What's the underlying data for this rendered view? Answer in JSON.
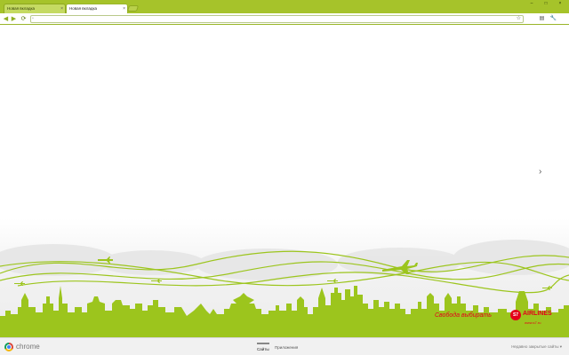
{
  "tabs": [
    {
      "title": "Новая вкладка",
      "active": false
    },
    {
      "title": "Новая вкладка",
      "active": true
    }
  ],
  "window_controls": {
    "minimize": "‒",
    "maximize": "□",
    "close": "×"
  },
  "toolbar": {
    "back": "◀",
    "forward": "▶",
    "reload": "⟳",
    "home": "⌂",
    "address_value": "",
    "star": "☆",
    "page_menu": "▤",
    "wrench_menu": "🔧"
  },
  "content": {
    "next_arrow": "›",
    "slogan": "Свобода выбирать",
    "brand": "AIRLINES",
    "brand_logo_text": "S7",
    "brand_url": "www.s7.ru"
  },
  "bottom_bar": {
    "logo_text": "chrome",
    "tabs": [
      {
        "label": "Сайты",
        "active": true
      },
      {
        "label": "Приложения",
        "active": false
      }
    ],
    "recently_closed": "Недавно закрытые сайты ▾"
  },
  "colors": {
    "accent": "#a6c32a",
    "silhouette": "#9cc51d",
    "brand": "#e4001b"
  }
}
